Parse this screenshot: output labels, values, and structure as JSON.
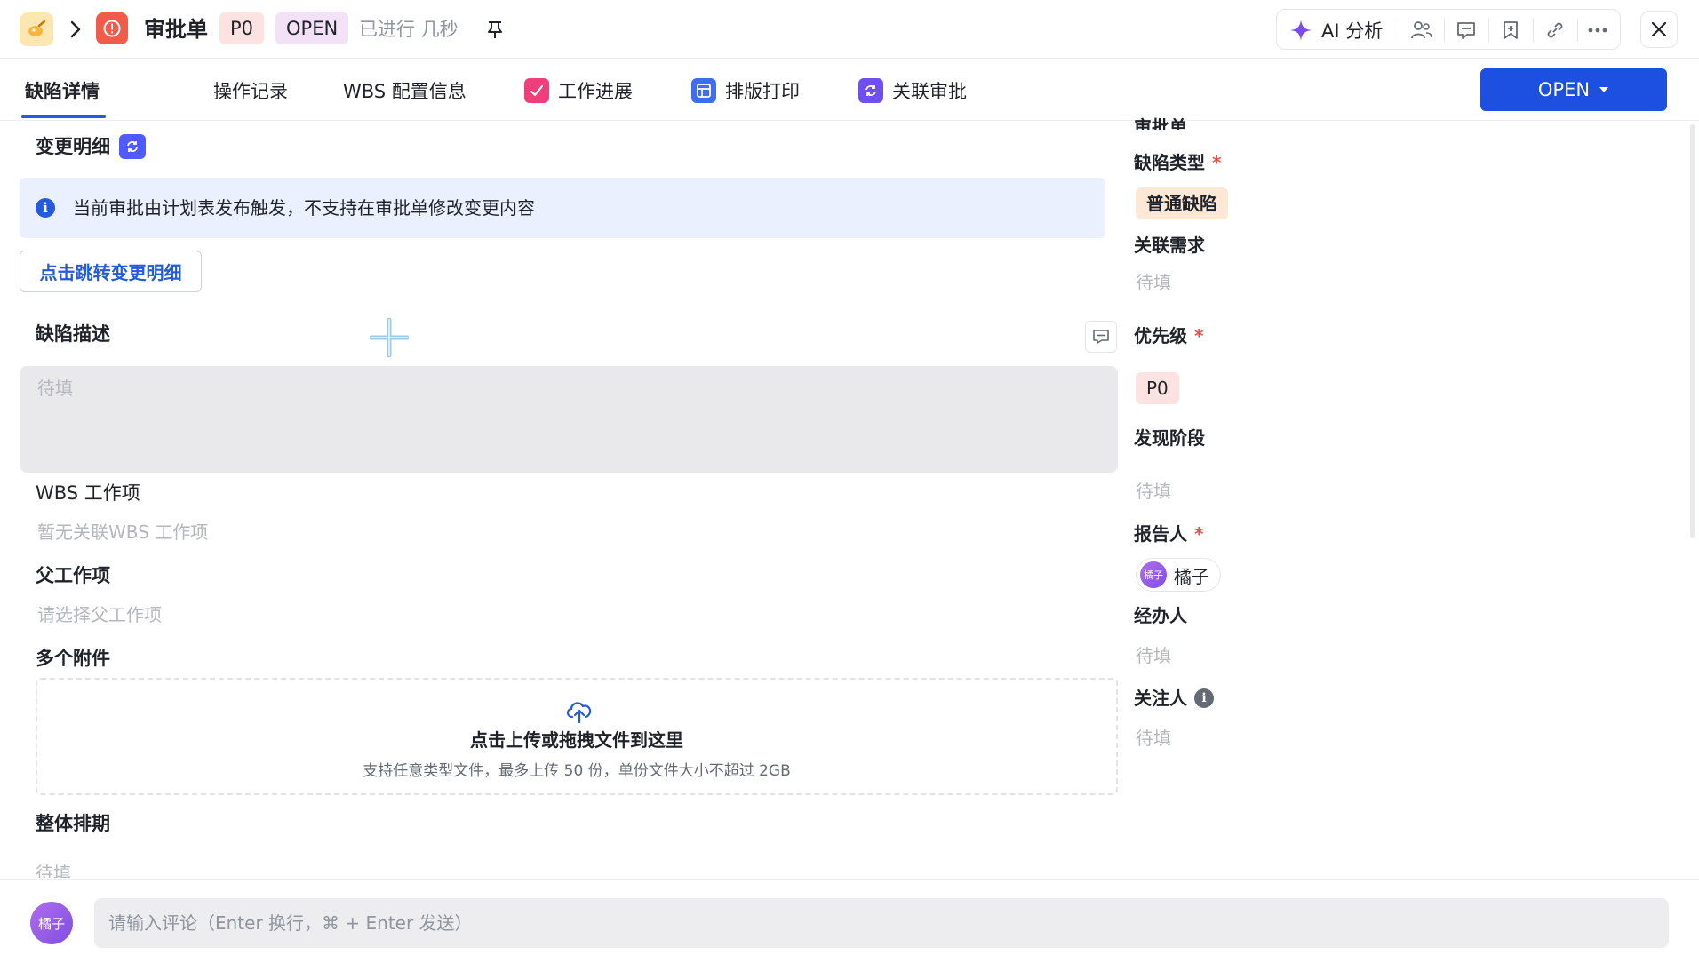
{
  "header": {
    "title": "审批单",
    "priority_tag": "P0",
    "status_tag": "OPEN",
    "elapsed": "已进行 几秒",
    "ai_label": "AI 分析"
  },
  "tabs": [
    {
      "label": "缺陷详情",
      "active": true
    },
    {
      "label": "操作记录"
    },
    {
      "label": "WBS 配置信息"
    },
    {
      "label": "工作进展"
    },
    {
      "label": "排版打印"
    },
    {
      "label": "关联审批"
    }
  ],
  "status_button": {
    "label": "OPEN"
  },
  "main": {
    "change_section_label": "变更明细",
    "info_banner": "当前审批由计划表发布触发，不支持在审批单修改变更内容",
    "jump_button": "点击跳转变更明细",
    "description_label": "缺陷描述",
    "description_placeholder": "待填",
    "wbs_label": "WBS 工作项",
    "wbs_placeholder": "暂无关联WBS 工作项",
    "parent_label": "父工作项",
    "parent_placeholder": "请选择父工作项",
    "attachments_label": "多个附件",
    "upload_title": "点击上传或拖拽文件到这里",
    "upload_hint": "支持任意类型文件，最多上传 50 份，单份文件大小不超过 2GB",
    "schedule_label": "整体排期",
    "schedule_placeholder": "待填"
  },
  "sidebar": {
    "cut_top_label": "审批单",
    "defect_type_label": "缺陷类型",
    "defect_type_value": "普通缺陷",
    "related_req_label": "关联需求",
    "related_req_value": "待填",
    "priority_label": "优先级",
    "priority_value": "P0",
    "stage_label": "发现阶段",
    "stage_value": "待填",
    "reporter_label": "报告人",
    "reporter_name": "橘子",
    "handler_label": "经办人",
    "handler_value": "待填",
    "follower_label": "关注人",
    "follower_value": "待填",
    "required_mark": "*"
  },
  "comment": {
    "avatar_text": "橘子",
    "placeholder": "请输入评论（Enter 换行，⌘ + Enter 发送）"
  },
  "colors": {
    "accent": "#1d4fe0",
    "link": "#245bdb",
    "required": "#f54a45",
    "type_icon": "#f25a4a"
  }
}
